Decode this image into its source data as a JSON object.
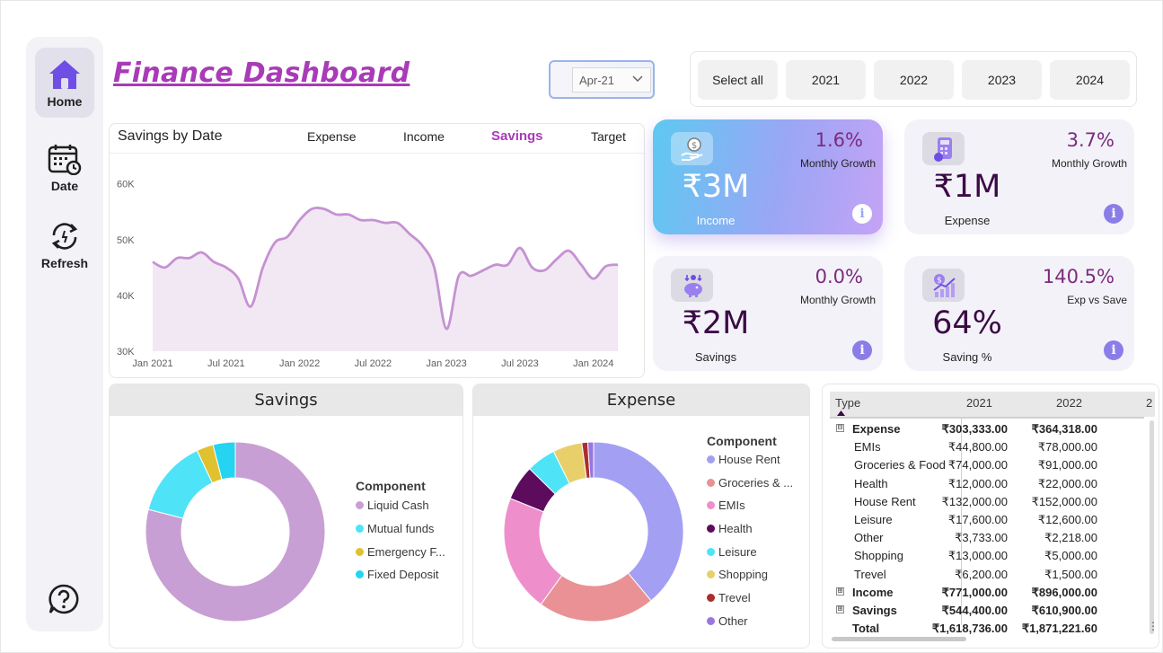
{
  "nav": {
    "items": [
      {
        "label": "Home",
        "icon": "home-icon"
      },
      {
        "label": "Date",
        "icon": "calendar-icon"
      },
      {
        "label": "Refresh",
        "icon": "refresh-icon"
      }
    ],
    "help_icon": "help-icon"
  },
  "title": "Finance Dashboard",
  "date_filter": {
    "value": "Apr-21"
  },
  "year_slicer": {
    "options": [
      "Select all",
      "2021",
      "2022",
      "2023",
      "2024"
    ]
  },
  "line_chart": {
    "title": "Savings by Date",
    "tabs": [
      "Expense",
      "Income",
      "Savings",
      "Target"
    ],
    "active_tab": "Savings"
  },
  "kpis": [
    {
      "value": "₹3M",
      "label": "Income",
      "pct": "1.6%",
      "sub": "Monthly Growth",
      "icon": "income-hand-coin-icon",
      "info": "i"
    },
    {
      "value": "₹1M",
      "label": "Expense",
      "pct": "3.7%",
      "sub": "Monthly Growth",
      "icon": "calculator-icon",
      "info": "i"
    },
    {
      "value": "₹2M",
      "label": "Savings",
      "pct": "0.0%",
      "sub": "Monthly Growth",
      "icon": "piggy-bank-icon",
      "info": "i"
    },
    {
      "value": "64%",
      "label": "Saving %",
      "pct": "140.5%",
      "sub": "Exp vs Save",
      "icon": "growth-chart-icon",
      "info": "i"
    }
  ],
  "savings_donut": {
    "title": "Savings",
    "legend_title": "Component",
    "items": [
      {
        "label": "Liquid Cash",
        "color": "#c89fd4"
      },
      {
        "label": "Mutual funds",
        "color": "#4fe3f7"
      },
      {
        "label": "Emergency F...",
        "color": "#e0c12f"
      },
      {
        "label": "Fixed Deposit",
        "color": "#24d4f0"
      }
    ]
  },
  "expense_donut": {
    "title": "Expense",
    "legend_title": "Component",
    "items": [
      {
        "label": "House Rent",
        "color": "#a3a0f3"
      },
      {
        "label": "Groceries & ...",
        "color": "#e99194"
      },
      {
        "label": "EMIs",
        "color": "#ee8fcc"
      },
      {
        "label": "Health",
        "color": "#5c0b5d"
      },
      {
        "label": "Leisure",
        "color": "#4fe3f7"
      },
      {
        "label": "Shopping",
        "color": "#e9cf6a"
      },
      {
        "label": "Trevel",
        "color": "#a92e2e"
      },
      {
        "label": "Other",
        "color": "#9a76e0"
      }
    ]
  },
  "matrix": {
    "headers": [
      "Type",
      "2021",
      "2022",
      "2"
    ],
    "rows": [
      {
        "label": "Expense",
        "v2021": "₹303,333.00",
        "v2022": "₹364,318.00",
        "bold": true,
        "expander": "⊟",
        "indent": 0
      },
      {
        "label": "EMIs",
        "v2021": "₹44,800.00",
        "v2022": "₹78,000.00",
        "bold": false,
        "indent": 1
      },
      {
        "label": "Groceries & Food",
        "v2021": "₹74,000.00",
        "v2022": "₹91,000.00",
        "bold": false,
        "indent": 1
      },
      {
        "label": "Health",
        "v2021": "₹12,000.00",
        "v2022": "₹22,000.00",
        "bold": false,
        "indent": 1
      },
      {
        "label": "House Rent",
        "v2021": "₹132,000.00",
        "v2022": "₹152,000.00",
        "bold": false,
        "indent": 1
      },
      {
        "label": "Leisure",
        "v2021": "₹17,600.00",
        "v2022": "₹12,600.00",
        "bold": false,
        "indent": 1
      },
      {
        "label": "Other",
        "v2021": "₹3,733.00",
        "v2022": "₹2,218.00",
        "bold": false,
        "indent": 1
      },
      {
        "label": "Shopping",
        "v2021": "₹13,000.00",
        "v2022": "₹5,000.00",
        "bold": false,
        "indent": 1
      },
      {
        "label": "Trevel",
        "v2021": "₹6,200.00",
        "v2022": "₹1,500.00",
        "bold": false,
        "indent": 1
      },
      {
        "label": "Income",
        "v2021": "₹771,000.00",
        "v2022": "₹896,000.00",
        "bold": true,
        "expander": "⊞",
        "indent": 0
      },
      {
        "label": "Savings",
        "v2021": "₹544,400.00",
        "v2022": "₹610,900.00",
        "bold": true,
        "expander": "⊞",
        "indent": 0
      },
      {
        "label": "Total",
        "v2021": "₹1,618,736.00",
        "v2022": "₹1,871,221.60",
        "bold": true,
        "indent": 0
      }
    ]
  },
  "chart_data": [
    {
      "type": "area",
      "title": "Savings by Date",
      "xlabel": "",
      "ylabel": "",
      "x_ticks": [
        "Jan 2021",
        "Jul 2021",
        "Jan 2022",
        "Jul 2022",
        "Jan 2023",
        "Jul 2023",
        "Jan 2024"
      ],
      "y_ticks": [
        "30K",
        "40K",
        "50K",
        "60K"
      ],
      "ylim": [
        30000,
        63000
      ],
      "grid": false,
      "x": [
        "2021-01",
        "2021-02",
        "2021-03",
        "2021-04",
        "2021-05",
        "2021-06",
        "2021-07",
        "2021-08",
        "2021-09",
        "2021-10",
        "2021-11",
        "2021-12",
        "2022-01",
        "2022-02",
        "2022-03",
        "2022-04",
        "2022-05",
        "2022-06",
        "2022-07",
        "2022-08",
        "2022-09",
        "2022-10",
        "2022-11",
        "2022-12",
        "2023-01",
        "2023-02",
        "2023-03",
        "2023-04",
        "2023-05",
        "2023-06",
        "2023-07",
        "2023-08",
        "2023-09",
        "2023-10",
        "2023-11",
        "2023-12",
        "2024-01",
        "2024-02",
        "2024-03"
      ],
      "series": [
        {
          "values": [
            46000,
            45000,
            46700,
            46700,
            47700,
            46000,
            45000,
            43000,
            38000,
            45000,
            49500,
            50500,
            53500,
            55500,
            55500,
            54500,
            54500,
            53500,
            53500,
            53000,
            53000,
            51000,
            49000,
            45000,
            34000,
            43500,
            43500,
            44500,
            45500,
            45500,
            48500,
            45000,
            44500,
            46500,
            48000,
            45500,
            43000,
            45200,
            45500
          ]
        }
      ]
    },
    {
      "type": "pie",
      "title": "Savings",
      "legend_title": "Component",
      "categories": [
        "Liquid Cash",
        "Mutual funds",
        "Emergency F...",
        "Fixed Deposit"
      ],
      "values": [
        79,
        14,
        3,
        4
      ]
    },
    {
      "type": "pie",
      "title": "Expense",
      "legend_title": "Component",
      "categories": [
        "House Rent",
        "Groceries & ...",
        "EMIs",
        "Health",
        "Leisure",
        "Shopping",
        "Trevel",
        "Other"
      ],
      "values": [
        37,
        20,
        20,
        6,
        5,
        5,
        1,
        1
      ]
    }
  ]
}
